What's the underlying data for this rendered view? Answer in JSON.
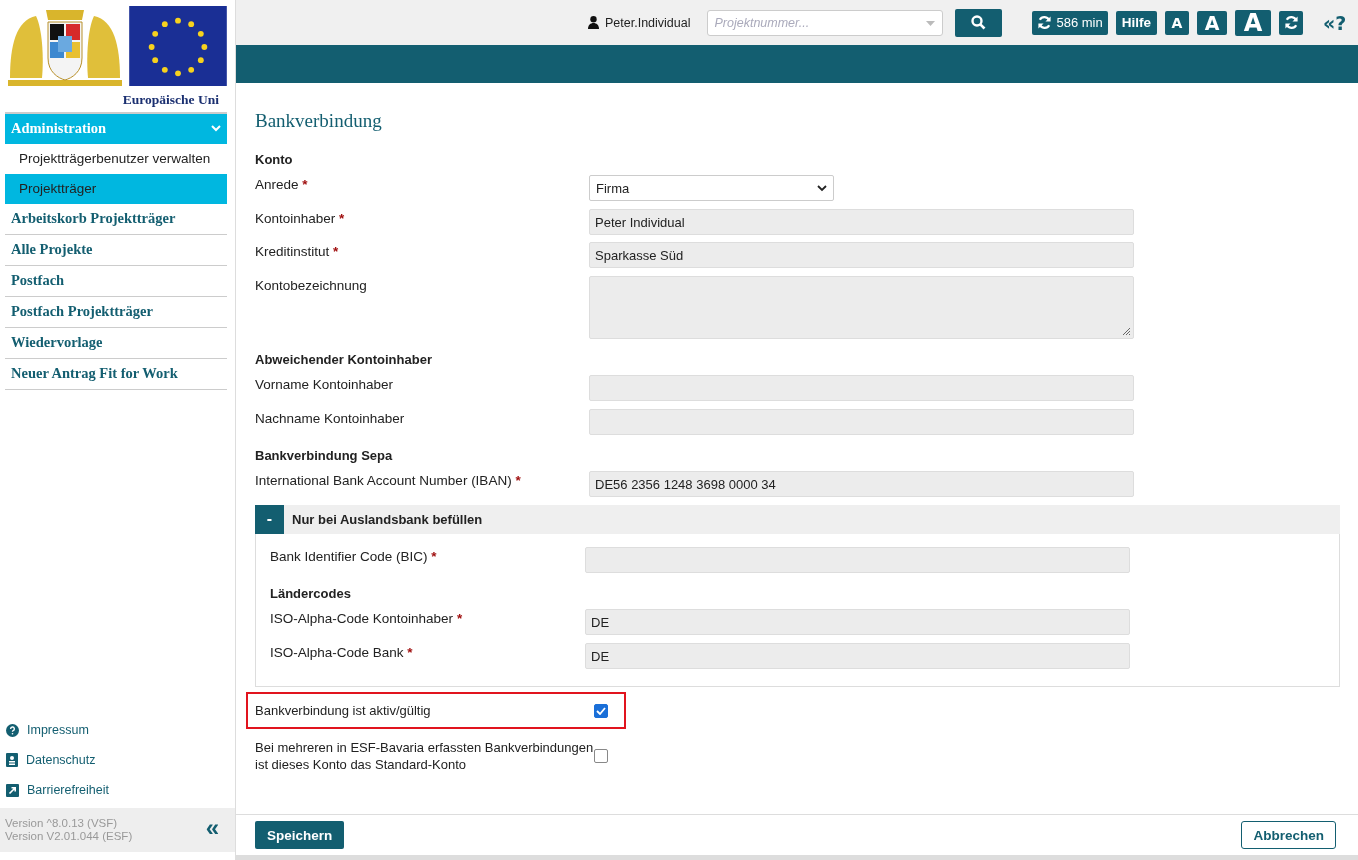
{
  "header": {
    "user": "Peter.Individual",
    "search_placeholder": "Projektnummer...",
    "timer": "586 min",
    "help": "Hilfe",
    "font_sizes": [
      "A",
      "A",
      "A"
    ],
    "back_help": "«?"
  },
  "logo_caption": "Europäische Uni",
  "sidebar": {
    "items": [
      {
        "label": "Administration",
        "selected": true,
        "expanded": true,
        "children": [
          {
            "label": "Projektträgerbenutzer verwalten",
            "selected": false
          },
          {
            "label": "Projektträger",
            "selected": true
          }
        ]
      },
      {
        "label": "Arbeitskorb Projektträger",
        "selected": false
      },
      {
        "label": "Alle Projekte",
        "selected": false
      },
      {
        "label": "Postfach",
        "selected": false
      },
      {
        "label": "Postfach Projektträger",
        "selected": false
      },
      {
        "label": "Wiedervorlage",
        "selected": false
      },
      {
        "label": "Neuer Antrag Fit for Work",
        "selected": false
      }
    ],
    "footer_links": [
      {
        "kind": "help",
        "label": "Impressum"
      },
      {
        "kind": "privacy",
        "label": "Datenschutz"
      },
      {
        "kind": "access",
        "label": "Barrierefreiheit"
      }
    ],
    "versions": [
      "Version ^8.0.13 (VSF)",
      "Version V2.01.044 (ESF)"
    ],
    "collapse": "«"
  },
  "page": {
    "title": "Bankverbindung",
    "items": [
      {
        "kind": "heading",
        "label": "Konto"
      },
      {
        "kind": "select",
        "label": "Anrede",
        "required_mark": "*",
        "value": "Firma"
      },
      {
        "kind": "input",
        "label": "Kontoinhaber",
        "required_mark": "*",
        "value": "Peter Individual"
      },
      {
        "kind": "input",
        "label": "Kreditinstitut",
        "required_mark": "*",
        "value": "Sparkasse Süd"
      },
      {
        "kind": "textarea",
        "label": "Kontobezeichnung"
      },
      {
        "kind": "heading",
        "label": "Abweichender Kontoinhaber"
      },
      {
        "kind": "input",
        "label": "Vorname Kontoinhaber"
      },
      {
        "kind": "input",
        "label": "Nachname Kontoinhaber"
      },
      {
        "kind": "heading",
        "label": "Bankverbindung Sepa"
      },
      {
        "kind": "input",
        "label": "International Bank Account Number (IBAN)",
        "required_mark": "*",
        "value": "DE56 2356 1248 3698 0000 34"
      },
      {
        "kind": "group",
        "toggle": "-",
        "title": "Nur bei Auslandsbank befüllen",
        "expanded": true,
        "items": [
          {
            "kind": "input",
            "label": "Bank Identifier Code (BIC)",
            "required_mark": "*"
          },
          {
            "kind": "heading",
            "label": "Ländercodes"
          },
          {
            "kind": "input",
            "label": "ISO-Alpha-Code Kontoinhaber",
            "required_mark": "*",
            "value": "DE"
          },
          {
            "kind": "input",
            "label": "ISO-Alpha-Code Bank",
            "required_mark": "*",
            "value": "DE"
          }
        ]
      },
      {
        "kind": "checkbox",
        "label": "Bankverbindung ist aktiv/gültig",
        "checked": true,
        "highlighted": true
      },
      {
        "kind": "checkbox",
        "label": "Bei mehreren in ESF-Bavaria erfassten Bankverbindungen ist dieses Konto das Standard-Konto",
        "checked": false,
        "highlighted": false
      }
    ]
  },
  "buttons": {
    "save": "Speichern",
    "cancel": "Abbrechen"
  }
}
